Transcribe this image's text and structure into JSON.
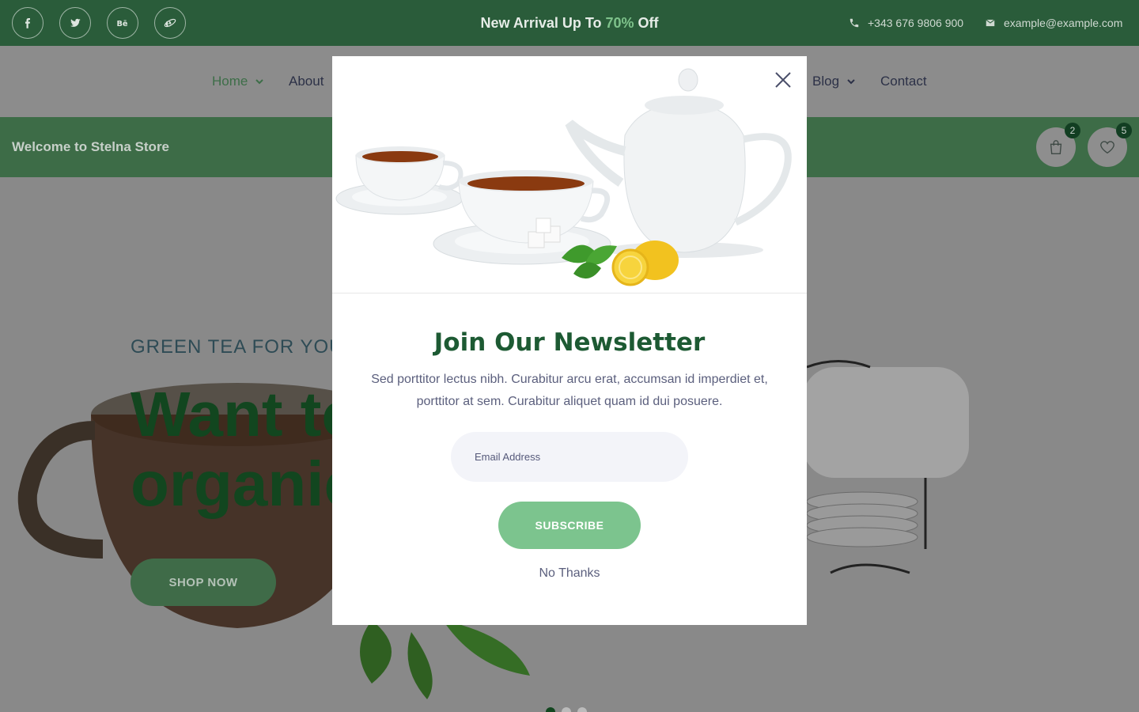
{
  "topbar": {
    "social": [
      {
        "name": "facebook-icon"
      },
      {
        "name": "twitter-icon"
      },
      {
        "name": "behance-icon"
      },
      {
        "name": "internet-explorer-icon"
      }
    ],
    "promo_before": "New Arrival Up To",
    "promo_accent": "70%",
    "promo_after": "Off",
    "phone": "+343 676 9806 900",
    "email": "example@example.com"
  },
  "nav": {
    "items": [
      {
        "label": "Home",
        "has_dropdown": true,
        "active": true
      },
      {
        "label": "About",
        "has_dropdown": false,
        "active": false
      },
      {
        "label": "Blog",
        "has_dropdown": true,
        "active": false
      },
      {
        "label": "Contact",
        "has_dropdown": false,
        "active": false
      }
    ]
  },
  "welcome": {
    "text": "Welcome to Stelna Store",
    "cart_count": "2",
    "wishlist_count": "5"
  },
  "hero": {
    "subtitle": "GREEN TEA FOR YOU",
    "title_line1": "Want to",
    "title_line2": "organic",
    "button": "SHOP NOW"
  },
  "modal": {
    "title": "Join Our Newsletter",
    "text": "Sed porttitor lectus nibh. Curabitur arcu erat, accumsan id imperdiet et, porttitor at sem. Curabitur aliquet quam id dui posuere.",
    "email_placeholder": "Email Address",
    "subscribe": "SUBSCRIBE",
    "no_thanks": "No Thanks"
  },
  "colors": {
    "brand_dark": "#2a5c3a",
    "brand_green": "#7cc48e",
    "heading_green": "#1d5a33",
    "overlay_gray": "#8c8c8c"
  }
}
